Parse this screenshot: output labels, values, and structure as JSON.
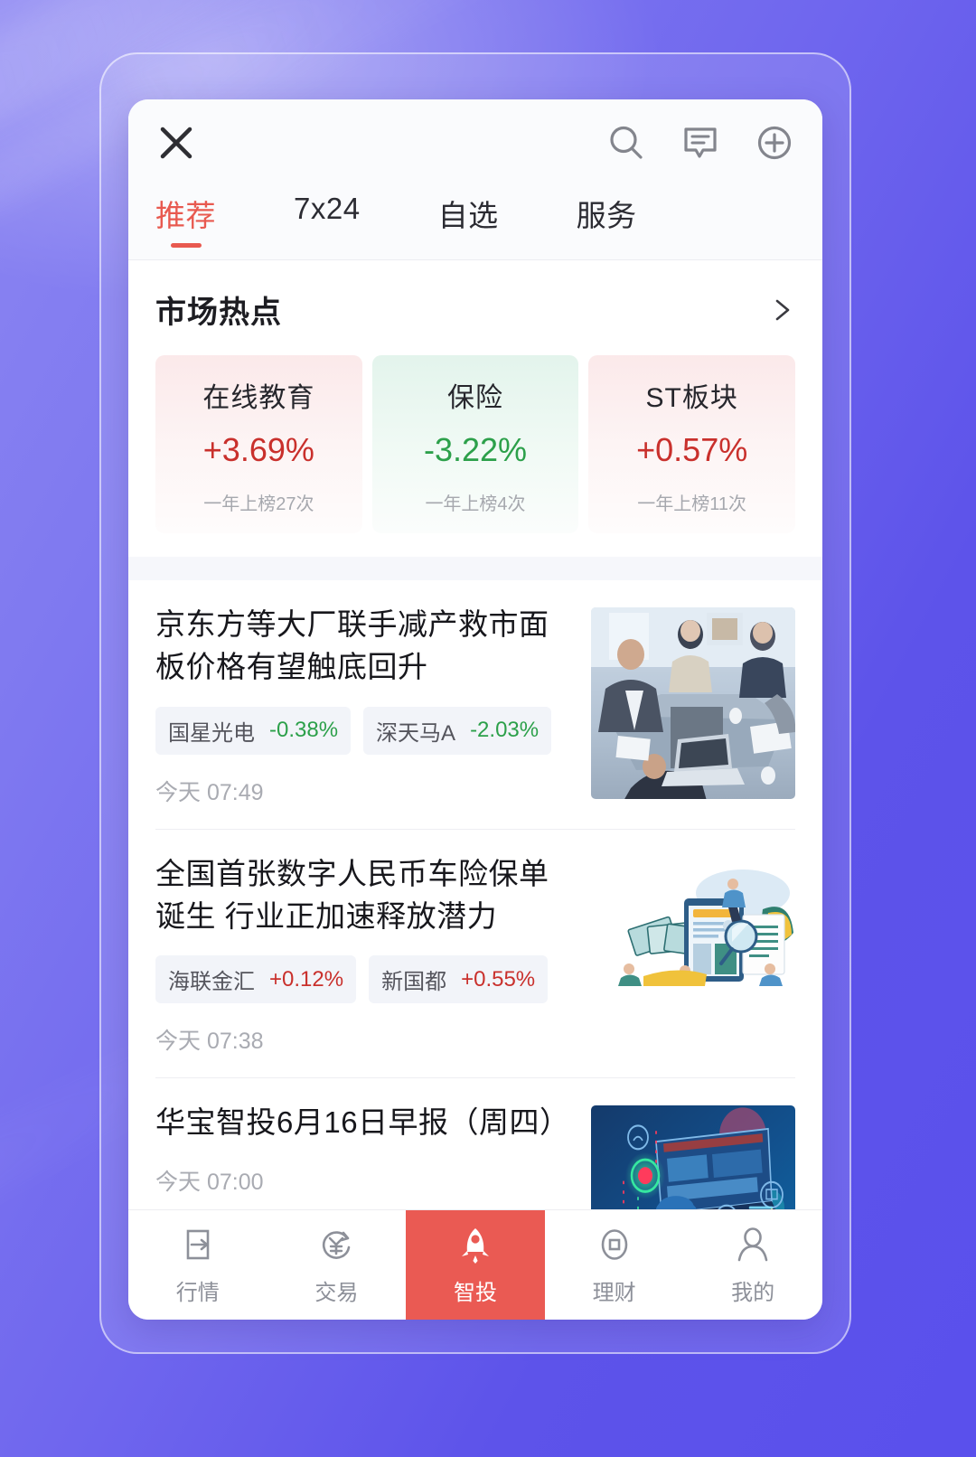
{
  "theme": {
    "accent_red": "#e8594f",
    "up_color": "#c9302c",
    "down_color": "#2ca04a",
    "background_purple": "#6f66ee"
  },
  "header": {
    "close_icon": "close-icon",
    "actions": [
      {
        "icon": "search-icon",
        "name": "search"
      },
      {
        "icon": "message-icon",
        "name": "message"
      },
      {
        "icon": "plus-circle-icon",
        "name": "add"
      }
    ]
  },
  "tabs": [
    {
      "label": "推荐",
      "active": true
    },
    {
      "label": "7x24",
      "active": false
    },
    {
      "label": "自选",
      "active": false
    },
    {
      "label": "服务",
      "active": false
    }
  ],
  "market_hotspot": {
    "title": "市场热点",
    "more_icon": "chevron-right-icon",
    "cards": [
      {
        "name": "在线教育",
        "percent": "+3.69%",
        "direction": "up",
        "sub": "一年上榜27次"
      },
      {
        "name": "保险",
        "percent": "-3.22%",
        "direction": "down",
        "sub": "一年上榜4次"
      },
      {
        "name": "ST板块",
        "percent": "+0.57%",
        "direction": "up",
        "sub": "一年上榜11次"
      }
    ]
  },
  "news": [
    {
      "title": "京东方等大厂联手减产救市面板价格有望触底回升",
      "tags": [
        {
          "name": "国星光电",
          "percent": "-0.38%",
          "direction": "down"
        },
        {
          "name": "深天马A",
          "percent": "-2.03%",
          "direction": "down"
        }
      ],
      "time": "今天 07:49",
      "thumb": "meeting-photo"
    },
    {
      "title": "全国首张数字人民币车险保单诞生 行业正加速释放潜力",
      "tags": [
        {
          "name": "海联金汇",
          "percent": "+0.12%",
          "direction": "up"
        },
        {
          "name": "新国都",
          "percent": "+0.55%",
          "direction": "up"
        }
      ],
      "time": "今天 07:38",
      "thumb": "fintech-illustration"
    },
    {
      "title": "华宝智投6月16日早报（周四）",
      "tags": [],
      "time": "今天 07:00",
      "thumb": "tech-illustration"
    }
  ],
  "bottom_nav": [
    {
      "label": "行情",
      "icon": "quotes-icon",
      "active": false
    },
    {
      "label": "交易",
      "icon": "trade-icon",
      "active": false
    },
    {
      "label": "智投",
      "icon": "rocket-icon",
      "active": true
    },
    {
      "label": "理财",
      "icon": "finance-icon",
      "active": false
    },
    {
      "label": "我的",
      "icon": "profile-icon",
      "active": false
    }
  ]
}
